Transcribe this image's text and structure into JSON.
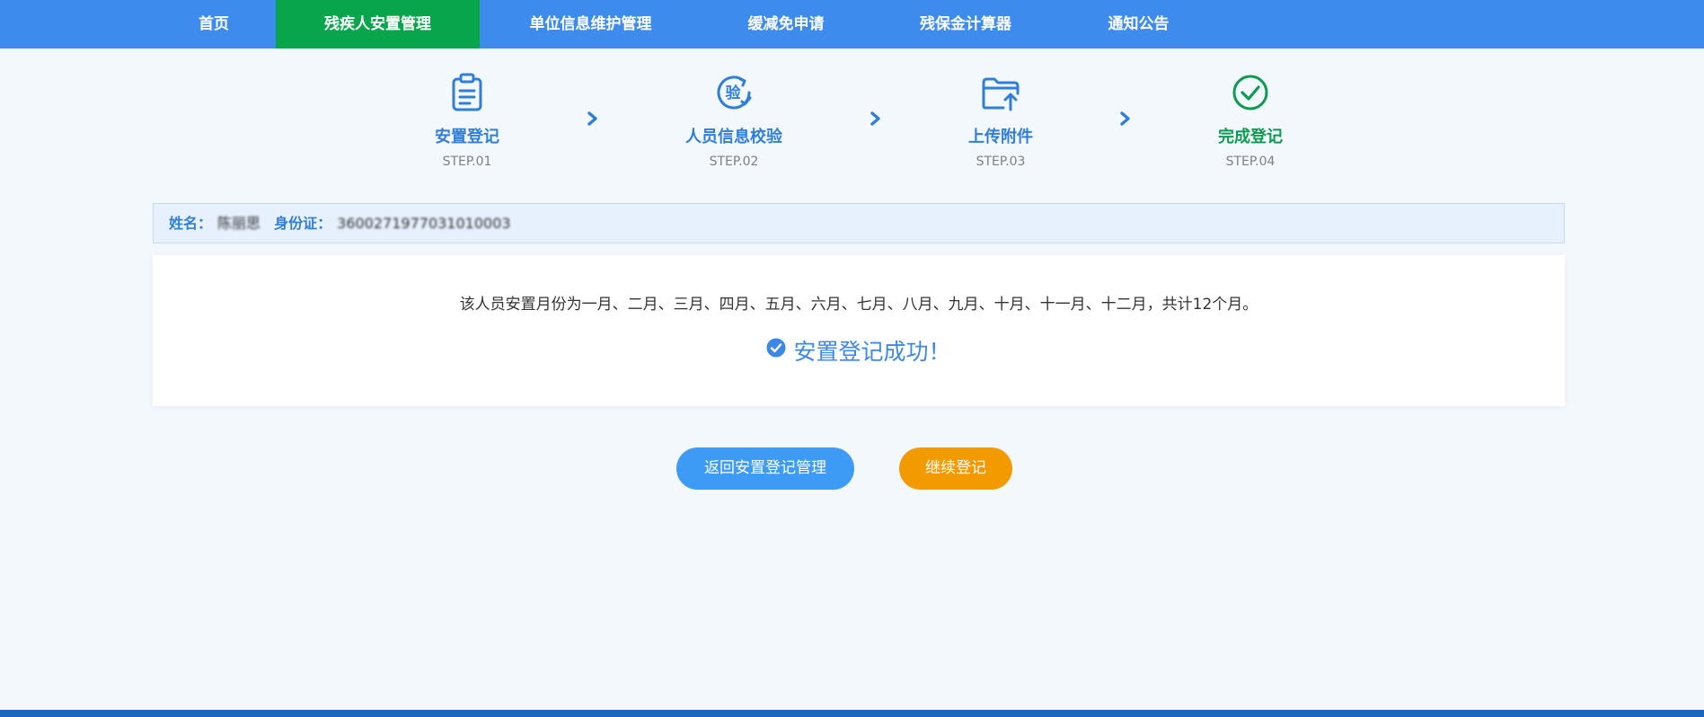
{
  "nav": {
    "items": [
      {
        "label": "首页",
        "active": false
      },
      {
        "label": "残疾人安置管理",
        "active": true
      },
      {
        "label": "单位信息维护管理",
        "active": false
      },
      {
        "label": "缓减免申请",
        "active": false
      },
      {
        "label": "残保金计算器",
        "active": false
      },
      {
        "label": "通知公告",
        "active": false
      }
    ],
    "active_color": "#08a54d",
    "bar_color": "#3e8bee"
  },
  "steps": [
    {
      "title": "安置登记",
      "sub": "STEP.01",
      "icon": "clipboard-icon"
    },
    {
      "title": "人员信息校验",
      "sub": "STEP.02",
      "icon": "verify-icon"
    },
    {
      "title": "上传附件",
      "sub": "STEP.03",
      "icon": "folder-upload-icon"
    },
    {
      "title": "完成登记",
      "sub": "STEP.04",
      "icon": "check-circle-icon",
      "done": true
    }
  ],
  "step_arrow_icon": "chevron-right-icon",
  "info": {
    "name_label": "姓名：",
    "name_value": "陈丽思",
    "id_label": "身份证：",
    "id_value": "3600271977031010003"
  },
  "result": {
    "message": "该人员安置月份为一月、二月、三月、四月、五月、六月、七月、八月、九月、十月、十一月、十二月，共计12个月。",
    "success_text": "安置登记成功！",
    "success_icon": "check-circle-filled-icon"
  },
  "buttons": {
    "back_label": "返回安置登记管理",
    "continue_label": "继续登记"
  },
  "colors": {
    "accent_blue": "#2f7ed8",
    "done_green": "#0d9b52",
    "continue_orange": "#f39a00"
  }
}
